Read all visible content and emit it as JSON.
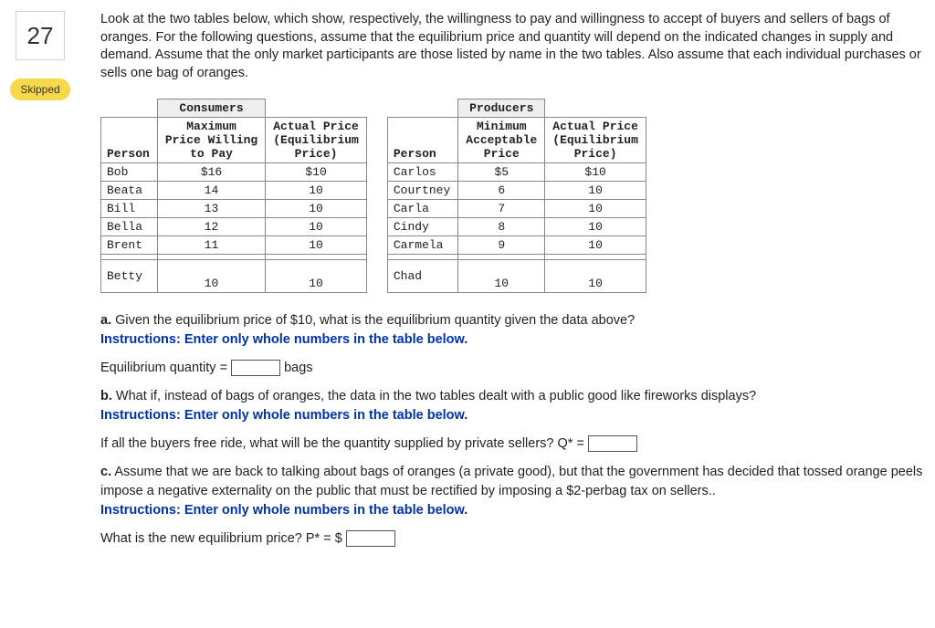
{
  "question_number": "27",
  "skipped_label": "Skipped",
  "intro": "Look at the two tables below, which show, respectively, the willingness to pay and willingness to accept of buyers and sellers of bags of oranges. For the following questions, assume that the equilibrium price and quantity will depend on the indicated changes in supply and demand. Assume that the only market participants are those listed by name in the two tables. Also assume that each individual purchases or sells one bag of oranges.",
  "consumers": {
    "title": "Consumers",
    "headers": {
      "person": "Person",
      "col1": "Maximum Price Willing to Pay",
      "col2": "Actual Price (Equilibrium Price)"
    },
    "rows": [
      {
        "person": "Bob",
        "max": "$16",
        "actual": "$10"
      },
      {
        "person": "Beata",
        "max": "14",
        "actual": "10"
      },
      {
        "person": "Bill",
        "max": "13",
        "actual": "10"
      },
      {
        "person": "Bella",
        "max": "12",
        "actual": "10"
      },
      {
        "person": "Brent",
        "max": "11",
        "actual": "10"
      }
    ],
    "extra": {
      "person": "Betty",
      "max": "10",
      "actual": "10"
    }
  },
  "producers": {
    "title": "Producers",
    "headers": {
      "person": "Person",
      "col1": "Minimum Acceptable Price",
      "col2": "Actual Price (Equilibrium Price)"
    },
    "rows": [
      {
        "person": "Carlos",
        "min": "$5",
        "actual": "$10"
      },
      {
        "person": "Courtney",
        "min": "6",
        "actual": "10"
      },
      {
        "person": "Carla",
        "min": "7",
        "actual": "10"
      },
      {
        "person": "Cindy",
        "min": "8",
        "actual": "10"
      },
      {
        "person": "Carmela",
        "min": "9",
        "actual": "10"
      }
    ],
    "extra": {
      "person": "Chad",
      "min": "10",
      "actual": "10"
    }
  },
  "partA": {
    "label": "a.",
    "text": " Given the equilibrium price of $10, what is the equilibrium quantity given the data above?",
    "instr": "Instructions: Enter only whole numbers in the table below.",
    "field_label_before": "Equilibrium quantity = ",
    "field_label_after": " bags"
  },
  "partB": {
    "label": "b.",
    "text": " What if, instead of bags of oranges, the data in the two tables dealt with a public good like fireworks displays?",
    "instr": "Instructions: Enter only whole numbers in the table below.",
    "field_label_before": "If all the buyers free ride, what will be the quantity supplied by private sellers? Q* = "
  },
  "partC": {
    "label": "c.",
    "text": " Assume that we are back to talking about bags of oranges (a private good), but that the government has decided that tossed orange peels impose a negative externality on the public that must be rectified by imposing a $2-perbag tax on sellers..",
    "instr": "Instructions: Enter only whole numbers in the table below.",
    "field_label_before": "What is the new equilibrium price? P* = $ "
  }
}
